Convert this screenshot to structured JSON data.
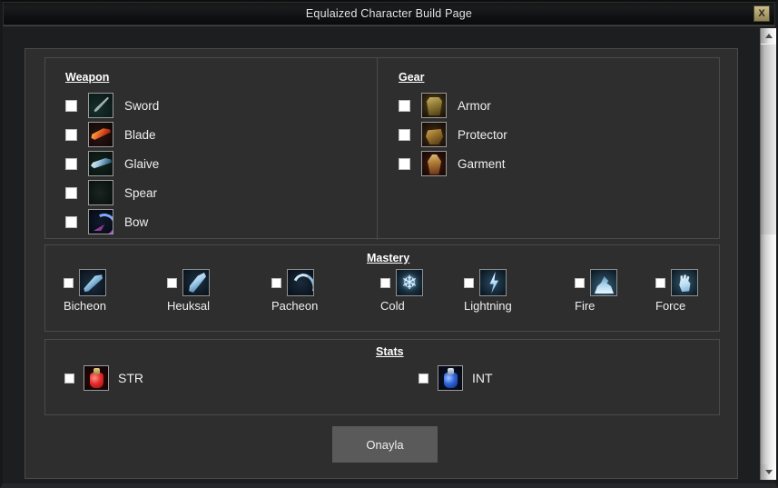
{
  "window": {
    "title": "Equlaized Character Build Page",
    "close_label": "X"
  },
  "scrollbar": {
    "up_arrow": "scroll-up",
    "down_arrow": "scroll-down"
  },
  "weapon": {
    "legend": "Weapon",
    "items": [
      {
        "label": "Sword",
        "icon": "sword-icon",
        "checked": false
      },
      {
        "label": "Blade",
        "icon": "blade-icon",
        "checked": false
      },
      {
        "label": "Glaive",
        "icon": "glaive-icon",
        "checked": false
      },
      {
        "label": "Spear",
        "icon": "spear-icon",
        "checked": false
      },
      {
        "label": "Bow",
        "icon": "bow-icon",
        "checked": false
      }
    ]
  },
  "gear": {
    "legend": "Gear",
    "items": [
      {
        "label": "Armor",
        "icon": "armor-icon",
        "checked": false
      },
      {
        "label": "Protector",
        "icon": "protector-icon",
        "checked": false
      },
      {
        "label": "Garment",
        "icon": "garment-icon",
        "checked": false
      }
    ]
  },
  "mastery": {
    "legend": "Mastery",
    "items": [
      {
        "label": "Bicheon",
        "icon": "bicheon-icon",
        "checked": false
      },
      {
        "label": "Heuksal",
        "icon": "heuksal-icon",
        "checked": false
      },
      {
        "label": "Pacheon",
        "icon": "pacheon-icon",
        "checked": false
      },
      {
        "label": "Cold",
        "icon": "cold-icon",
        "checked": false
      },
      {
        "label": "Lightning",
        "icon": "lightning-icon",
        "checked": false
      },
      {
        "label": "Fire",
        "icon": "fire-icon",
        "checked": false
      },
      {
        "label": "Force",
        "icon": "force-icon",
        "checked": false
      }
    ]
  },
  "stats": {
    "legend": "Stats",
    "items": [
      {
        "label": "STR",
        "icon": "str-potion-icon",
        "checked": false
      },
      {
        "label": "INT",
        "icon": "int-potion-icon",
        "checked": false
      }
    ]
  },
  "submit": {
    "label": "Onayla"
  },
  "colors": {
    "panel_bg": "#2e2e2e",
    "window_bg": "#2b2b2b",
    "border": "#4a4a4a",
    "text": "#efefef",
    "button_bg": "#5a5a5a",
    "close_btn": "#cdbe8b"
  }
}
